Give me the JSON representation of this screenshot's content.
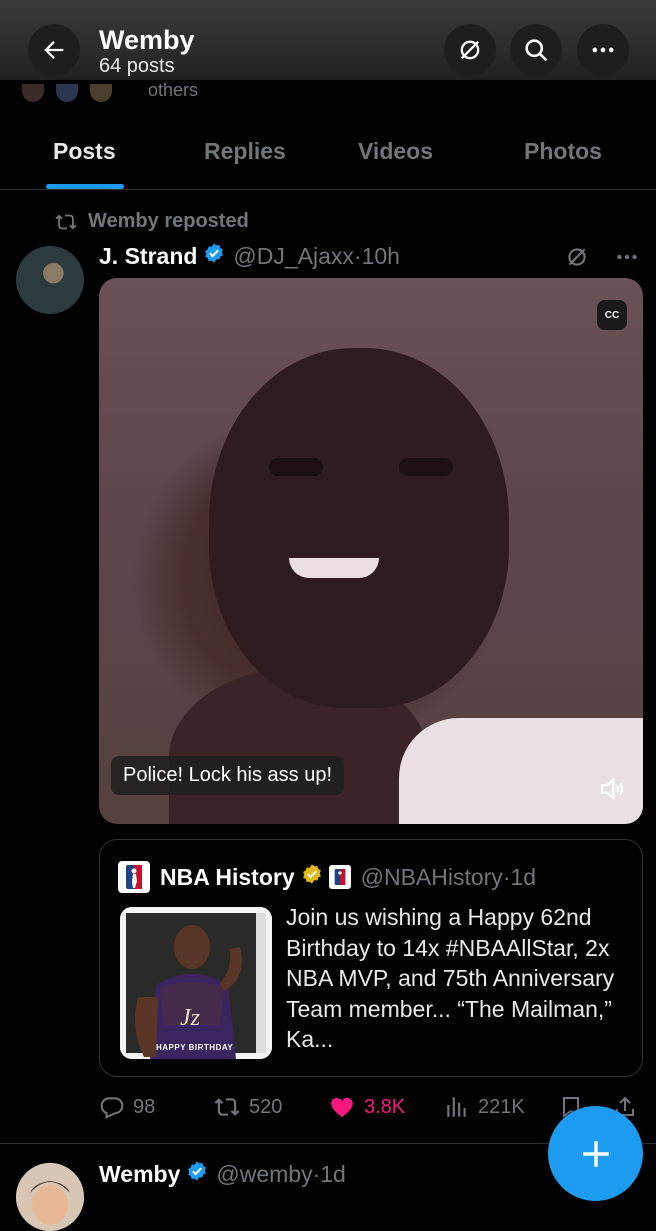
{
  "header": {
    "title": "Wemby",
    "post_count": "64 posts",
    "peek_text": "others"
  },
  "tabs": [
    {
      "label": "Posts",
      "active": true
    },
    {
      "label": "Replies",
      "active": false
    },
    {
      "label": "Videos",
      "active": false
    },
    {
      "label": "Photos",
      "active": false
    }
  ],
  "post": {
    "repost_label": "Wemby reposted",
    "author_name": "J. Strand",
    "handle": "@DJ_Ajaxx",
    "time": "10h",
    "caption": "Police! Lock his ass up!",
    "cc_label": "CC",
    "quote": {
      "name": "NBA History",
      "handle": "@NBAHistory",
      "time": "1d",
      "text": "Join us wishing a Happy 62nd Birthday to 14x #NBAAllStar, 2x NBA MVP, and 75th Anniversary Team member... “The Mailman,” Ka...",
      "image_text": "HAPPY BIRTHDAY"
    },
    "stats": {
      "replies": "98",
      "reposts": "520",
      "likes": "3.8K",
      "views": "221K"
    }
  },
  "next_post": {
    "author_name": "Wemby",
    "handle": "@wemby",
    "time": "1d"
  },
  "colors": {
    "accent": "#1d9bf0",
    "like": "#f91880",
    "muted": "#71767b",
    "gold_badge": "#e2b719"
  }
}
